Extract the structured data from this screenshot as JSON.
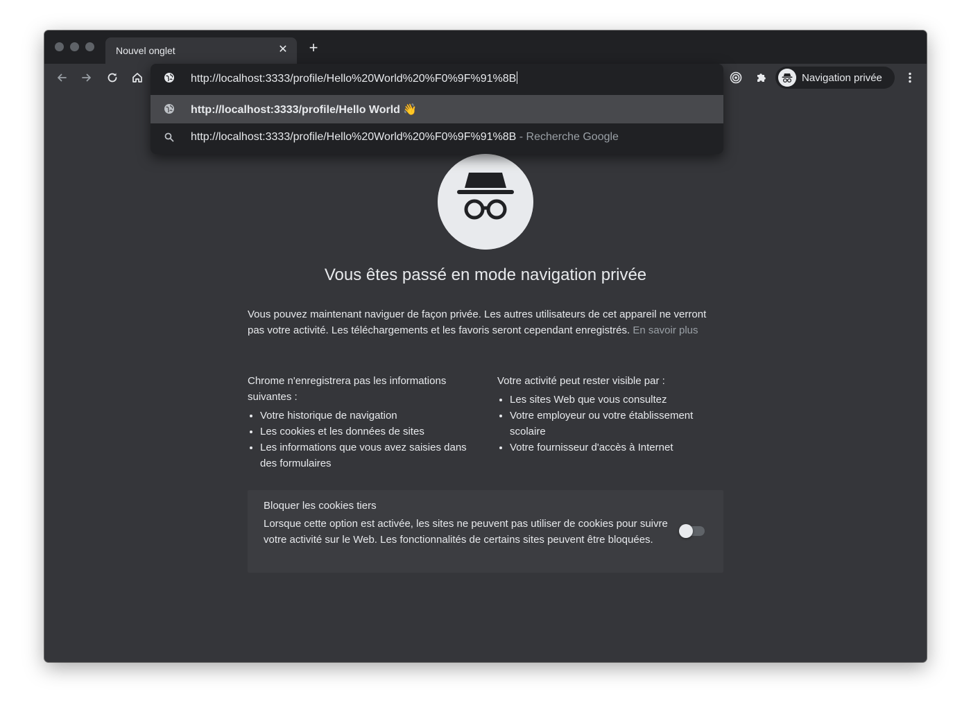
{
  "window": {
    "tab_title": "Nouvel onglet",
    "tab_close_glyph": "✕",
    "new_tab_glyph": "+"
  },
  "toolbar": {
    "profile_label": "Navigation privée"
  },
  "omnibox": {
    "input_value": "http://localhost:3333/profile/Hello%20World%20%F0%9F%91%8B",
    "suggestions": [
      {
        "icon": "globe-icon",
        "text": "http://localhost:3333/profile/Hello World 👋",
        "suffix": ""
      },
      {
        "icon": "search-icon",
        "text": "http://localhost:3333/profile/Hello%20World%20%F0%9F%91%8B",
        "suffix": "- Recherche Google"
      }
    ]
  },
  "page": {
    "heading": "Vous êtes passé en mode navigation privée",
    "intro_text": "Vous pouvez maintenant naviguer de façon privée. Les autres utilisateurs de cet appareil ne verront pas votre activité. Les téléchargements et les favoris seront cependant enregistrés.",
    "learn_more": "En savoir plus",
    "left_column": {
      "title": "Chrome n'enregistrera pas les informations suivantes :",
      "items": [
        "Votre historique de navigation",
        "Les cookies et les données de sites",
        "Les informations que vous avez saisies dans des formulaires"
      ]
    },
    "right_column": {
      "title": "Votre activité peut rester visible par :",
      "items": [
        "Les sites Web que vous consultez",
        "Votre employeur ou votre établissement scolaire",
        "Votre fournisseur d'accès à Internet"
      ]
    },
    "cookie_card": {
      "title": "Bloquer les cookies tiers",
      "description": "Lorsque cette option est activée, les sites ne peuvent pas utiliser de cookies pour suivre votre activité sur le Web. Les fonctionnalités de certains sites peuvent être bloquées.",
      "toggle_on": false
    }
  },
  "colors": {
    "frame": "#202124",
    "toolbar": "#35363a",
    "text": "#e8eaed",
    "muted": "#9aa0a6"
  }
}
